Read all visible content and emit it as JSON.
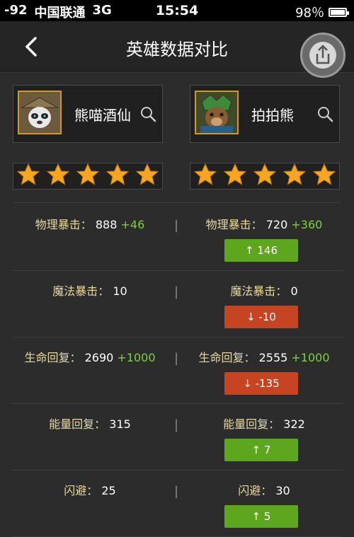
{
  "status_bar": {
    "signal": "-92",
    "carrier": "中国联通",
    "network": "3G",
    "time": "15:54",
    "battery_percent": "98％",
    "battery_level": 0.98
  },
  "nav": {
    "title": "英雄数据对比",
    "back_icon": "chevron-left-icon",
    "share_icon": "share-upload-icon"
  },
  "heroes": [
    {
      "name": "熊喵酒仙",
      "stars": 5
    },
    {
      "name": "拍拍熊",
      "stars": 5
    }
  ],
  "stats": [
    {
      "left": {
        "label": "物理暴击：",
        "value": "888",
        "bonus": "+46"
      },
      "right": {
        "label": "物理暴击：",
        "value": "720",
        "bonus": "+360"
      },
      "diff": {
        "text": "↑ 146",
        "direction": "up"
      }
    },
    {
      "left": {
        "label": "魔法暴击：",
        "value": "10",
        "bonus": ""
      },
      "right": {
        "label": "魔法暴击：",
        "value": "0",
        "bonus": ""
      },
      "diff": {
        "text": "↓ -10",
        "direction": "down"
      }
    },
    {
      "left": {
        "label": "生命回复：",
        "value": "2690",
        "bonus": "+1000"
      },
      "right": {
        "label": "生命回复：",
        "value": "2555",
        "bonus": "+1000"
      },
      "diff": {
        "text": "↓ -135",
        "direction": "down"
      }
    },
    {
      "left": {
        "label": "能量回复：",
        "value": "315",
        "bonus": ""
      },
      "right": {
        "label": "能量回复：",
        "value": "322",
        "bonus": ""
      },
      "diff": {
        "text": "↑ 7",
        "direction": "up"
      }
    },
    {
      "left": {
        "label": "闪避：",
        "value": "25",
        "bonus": ""
      },
      "right": {
        "label": "闪避：",
        "value": "30",
        "bonus": ""
      },
      "diff": {
        "text": "↑ 5",
        "direction": "up"
      }
    }
  ],
  "colors": {
    "up": "#5da61d",
    "down": "#c64422",
    "bonus": "#7bd13a",
    "label": "#e6d7a5",
    "star": "#f5a623"
  }
}
